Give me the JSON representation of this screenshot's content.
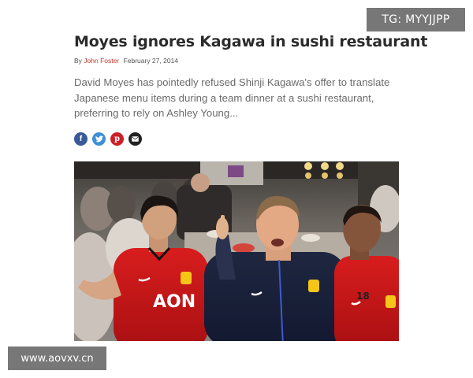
{
  "article": {
    "title": "Moyes ignores Kagawa in sushi restaurant",
    "byline_prefix": "By",
    "author": "John Foster",
    "date": "February 27, 2014",
    "summary": "David Moyes has pointedly refused Shinji Kagawa's offer to translate Japanese menu items during a team dinner at a sushi restaurant, preferring to rely on Ashley Young..."
  },
  "share": [
    {
      "icon": "facebook-icon",
      "glyph": "f",
      "color": "#3b5998"
    },
    {
      "icon": "twitter-icon",
      "glyph": "t",
      "color": "#3d8fd6"
    },
    {
      "icon": "pinterest-icon",
      "glyph": "p",
      "color": "#cb2027"
    },
    {
      "icon": "email-icon",
      "glyph": "✉",
      "color": "#222222"
    }
  ],
  "photo": {
    "sponsor_text": "AON",
    "number_text": "18"
  },
  "watermarks": {
    "top_right": "TG: MYYJJPP",
    "bottom_left": "www.aovxv.cn"
  }
}
